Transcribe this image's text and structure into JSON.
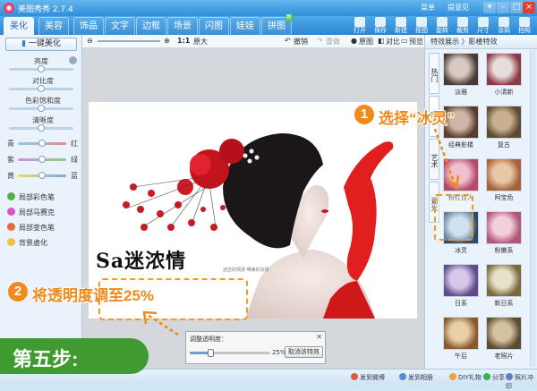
{
  "window": {
    "title": "美图秀秀 2.7.4",
    "links": [
      "菜单",
      "提意见"
    ]
  },
  "tabs": [
    {
      "label": "美化",
      "active": true
    },
    {
      "label": "美容"
    },
    {
      "label": "饰品"
    },
    {
      "label": "文字"
    },
    {
      "label": "边框"
    },
    {
      "label": "场景"
    },
    {
      "label": "闪图"
    },
    {
      "label": "娃娃"
    },
    {
      "label": "拼图",
      "badge": "新"
    }
  ],
  "toolbar": [
    "打开",
    "保存",
    "新建",
    "抠图",
    "旋转",
    "裁剪",
    "尺寸",
    "涂鸦",
    "拍照"
  ],
  "left_panel": {
    "one_click_label": "一键美化",
    "sliders": [
      "亮度",
      "对比度",
      "色彩饱和度",
      "清晰度"
    ],
    "color_balance": [
      {
        "left": "青",
        "right": "红"
      },
      {
        "left": "紫",
        "right": "绿"
      },
      {
        "left": "黄",
        "right": "蓝"
      }
    ],
    "tools": [
      {
        "label": "局部彩色笔",
        "icon": "colorpen-icon",
        "color": "#4ab34a"
      },
      {
        "label": "局部马赛克",
        "icon": "mosaic-icon",
        "color": "#d955c8"
      },
      {
        "label": "局部变色笔",
        "icon": "recolor-icon",
        "color": "#e6683c"
      },
      {
        "label": "背景虚化",
        "icon": "blur-icon",
        "color": "#f2c23a"
      }
    ]
  },
  "center_toolbar": {
    "zoom_ratio": "1:1",
    "actual_size_label": "原大",
    "undo_label": "撤销",
    "redo_label": "重做",
    "original_label": "原图",
    "compare_label": "对比",
    "preview_label": "预览"
  },
  "photo": {
    "slogan": "Sa迷浓情",
    "slogan_sub": "迷恋的情感 唯美的浓情"
  },
  "opacity_panel": {
    "label": "调整透明度：",
    "value_text": "25%",
    "value": 25,
    "cancel_label": "取消该特效"
  },
  "right_panel": {
    "breadcrumb": "特效展示 〉影楼特效",
    "side_tabs": [
      "热门",
      "时尚",
      "艺术",
      "调光"
    ],
    "effects": [
      {
        "label": "淡雅"
      },
      {
        "label": "小清新"
      },
      {
        "label": "经典影楼"
      },
      {
        "label": "复古"
      },
      {
        "label": "粉红佳人"
      },
      {
        "label": "阿宝色"
      },
      {
        "label": "冰灵",
        "selected": true
      },
      {
        "label": "粉嫩系"
      },
      {
        "label": "日系"
      },
      {
        "label": "新日系"
      },
      {
        "label": "午后"
      },
      {
        "label": "老照片"
      }
    ]
  },
  "statusbar": [
    {
      "label": "发到微博",
      "color": "#e05a3a"
    },
    {
      "label": "发到相册",
      "color": "#4a8fd8"
    },
    {
      "label": "DIY礼物",
      "color": "#f2a43a"
    },
    {
      "label": "分享",
      "color": "#3cae4e"
    },
    {
      "label": "照片冲印",
      "color": "#5a7fc8"
    }
  ],
  "annotations": {
    "step1_number": "1",
    "step1_text": "选择“冰灵”",
    "step2_number": "2",
    "step2_text": "将透明度调至25%",
    "banner": "第五步:"
  },
  "colors": {
    "accent": "#f08a1c",
    "title_bar": "#2f8fd9",
    "banner_green": "#3f9b2f"
  }
}
